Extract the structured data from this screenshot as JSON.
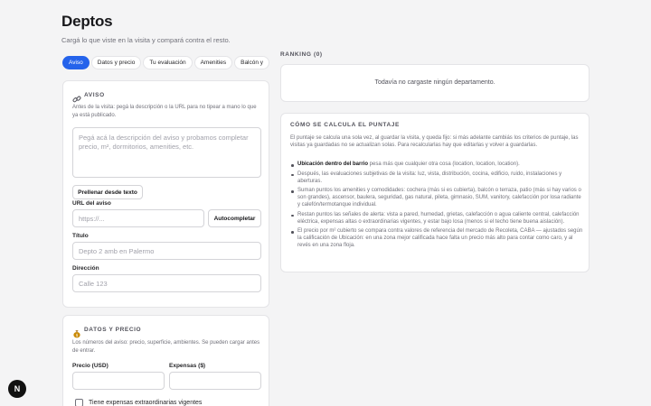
{
  "header": {
    "title": "Deptos",
    "subtitle": "Cargá lo que viste en la visita y compará contra el resto."
  },
  "tabs": [
    {
      "label": "Aviso",
      "active": true
    },
    {
      "label": "Datos y precio",
      "active": false
    },
    {
      "label": "Tu evaluación",
      "active": false
    },
    {
      "label": "Amenities",
      "active": false
    },
    {
      "label": "Balcón y",
      "active": false
    }
  ],
  "aviso": {
    "heading": "AVISO",
    "icon": "link-icon",
    "help": "Antes de la visita: pegá la descripción o la URL para no tipear a mano lo que ya está publicado.",
    "textarea_placeholder": "Pegá acá la descripción del aviso y probamos completar precio, m², dormitorios, amenities, etc.",
    "prefill_button": "Prellenar desde texto",
    "url_label": "URL del aviso",
    "url_placeholder": "https://...",
    "autocomplete_button": "Autocompletar",
    "title_label": "Título",
    "title_placeholder": "Depto 2 amb en Palermo",
    "address_label": "Dirección",
    "address_placeholder": "Calle 123"
  },
  "datos": {
    "heading": "DATOS Y PRECIO",
    "icon": "money-bag-icon",
    "help": "Los números del aviso: precio, superficie, ambientes. Se pueden cargar antes de entrar.",
    "price_label": "Precio (USD)",
    "expenses_label": "Expensas ($)",
    "extra_expenses_label": "Tiene expensas extraordinarias vigentes"
  },
  "ranking": {
    "label": "RANKING (0)",
    "empty_text": "Todavía no cargaste ningún departamento."
  },
  "calc": {
    "title": "CÓMO SE CALCULA EL PUNTAJE",
    "intro": "El puntaje se calcula una sola vez, al guardar la visita, y queda fijo: si más adelante cambiás los criterios de puntaje, las visitas ya guardadas no se actualizan solas. Para recalcularlas hay que editarlas y volver a guardarlas.",
    "items": [
      {
        "bold": "Ubicación dentro del barrio",
        "text": " pesa más que cualquier otra cosa (location, location, location)."
      },
      {
        "bold": "",
        "text": "Después, las evaluaciones subjetivas de la visita: luz, vista, distribución, cocina, edificio, ruido, instalaciones y aberturas."
      },
      {
        "bold": "",
        "text": "Suman puntos los amenities y comodidades: cochera (más si es cubierta), balcón o terraza, patio (más si hay varios o son grandes), ascensor, baulera, seguridad, gas natural, pileta, gimnasio, SUM, vanitory, calefacción por losa radiante y calefón/termotanque individual."
      },
      {
        "bold": "",
        "text": "Restan puntos las señales de alerta: vista a pared, humedad, grietas, calefacción o agua caliente central, calefacción eléctrica, expensas altas o extraordinarias vigentes, y estar bajo losa (menos si el techo tiene buena aislación)."
      },
      {
        "bold": "",
        "text": "El precio por m² cubierto se compara contra valores de referencia del mercado de Recoleta, CABA — ajustados según la calificación de Ubicación: en una zona mejor calificada hace falta un precio más alto para contar como caro, y al revés en una zona floja."
      }
    ]
  },
  "corner_badge": "N"
}
